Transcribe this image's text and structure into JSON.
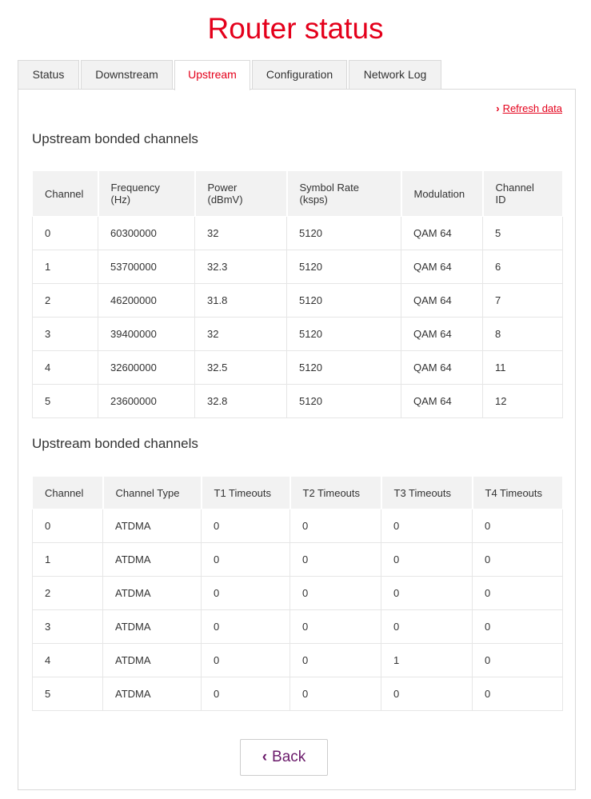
{
  "page": {
    "title": "Router status"
  },
  "tabs": [
    {
      "label": "Status"
    },
    {
      "label": "Downstream"
    },
    {
      "label": "Upstream"
    },
    {
      "label": "Configuration"
    },
    {
      "label": "Network Log"
    }
  ],
  "active_tab": "Upstream",
  "refresh": {
    "label": "Refresh data",
    "icon": "chevron-right-icon"
  },
  "table1": {
    "title": "Upstream bonded channels",
    "headers": [
      [
        "Channel"
      ],
      [
        "Frequency",
        "(Hz)"
      ],
      [
        "Power",
        "(dBmV)"
      ],
      [
        "Symbol Rate",
        "(ksps)"
      ],
      [
        "Modulation"
      ],
      [
        "Channel",
        "ID"
      ]
    ],
    "rows": [
      [
        "0",
        "60300000",
        "32",
        "5120",
        "QAM 64",
        "5"
      ],
      [
        "1",
        "53700000",
        "32.3",
        "5120",
        "QAM 64",
        "6"
      ],
      [
        "2",
        "46200000",
        "31.8",
        "5120",
        "QAM 64",
        "7"
      ],
      [
        "3",
        "39400000",
        "32",
        "5120",
        "QAM 64",
        "8"
      ],
      [
        "4",
        "32600000",
        "32.5",
        "5120",
        "QAM 64",
        "11"
      ],
      [
        "5",
        "23600000",
        "32.8",
        "5120",
        "QAM 64",
        "12"
      ]
    ]
  },
  "table2": {
    "title": "Upstream bonded channels",
    "headers": [
      "Channel",
      "Channel Type",
      "T1 Timeouts",
      "T2 Timeouts",
      "T3 Timeouts",
      "T4 Timeouts"
    ],
    "rows": [
      [
        "0",
        "ATDMA",
        "0",
        "0",
        "0",
        "0"
      ],
      [
        "1",
        "ATDMA",
        "0",
        "0",
        "0",
        "0"
      ],
      [
        "2",
        "ATDMA",
        "0",
        "0",
        "0",
        "0"
      ],
      [
        "3",
        "ATDMA",
        "0",
        "0",
        "0",
        "0"
      ],
      [
        "4",
        "ATDMA",
        "0",
        "0",
        "1",
        "0"
      ],
      [
        "5",
        "ATDMA",
        "0",
        "0",
        "0",
        "0"
      ]
    ]
  },
  "back": {
    "label": "Back",
    "icon": "chevron-left-icon"
  },
  "colors": {
    "accent": "#e4001b",
    "back_text": "#6a1a6a",
    "header_bg": "#f2f2f2"
  }
}
